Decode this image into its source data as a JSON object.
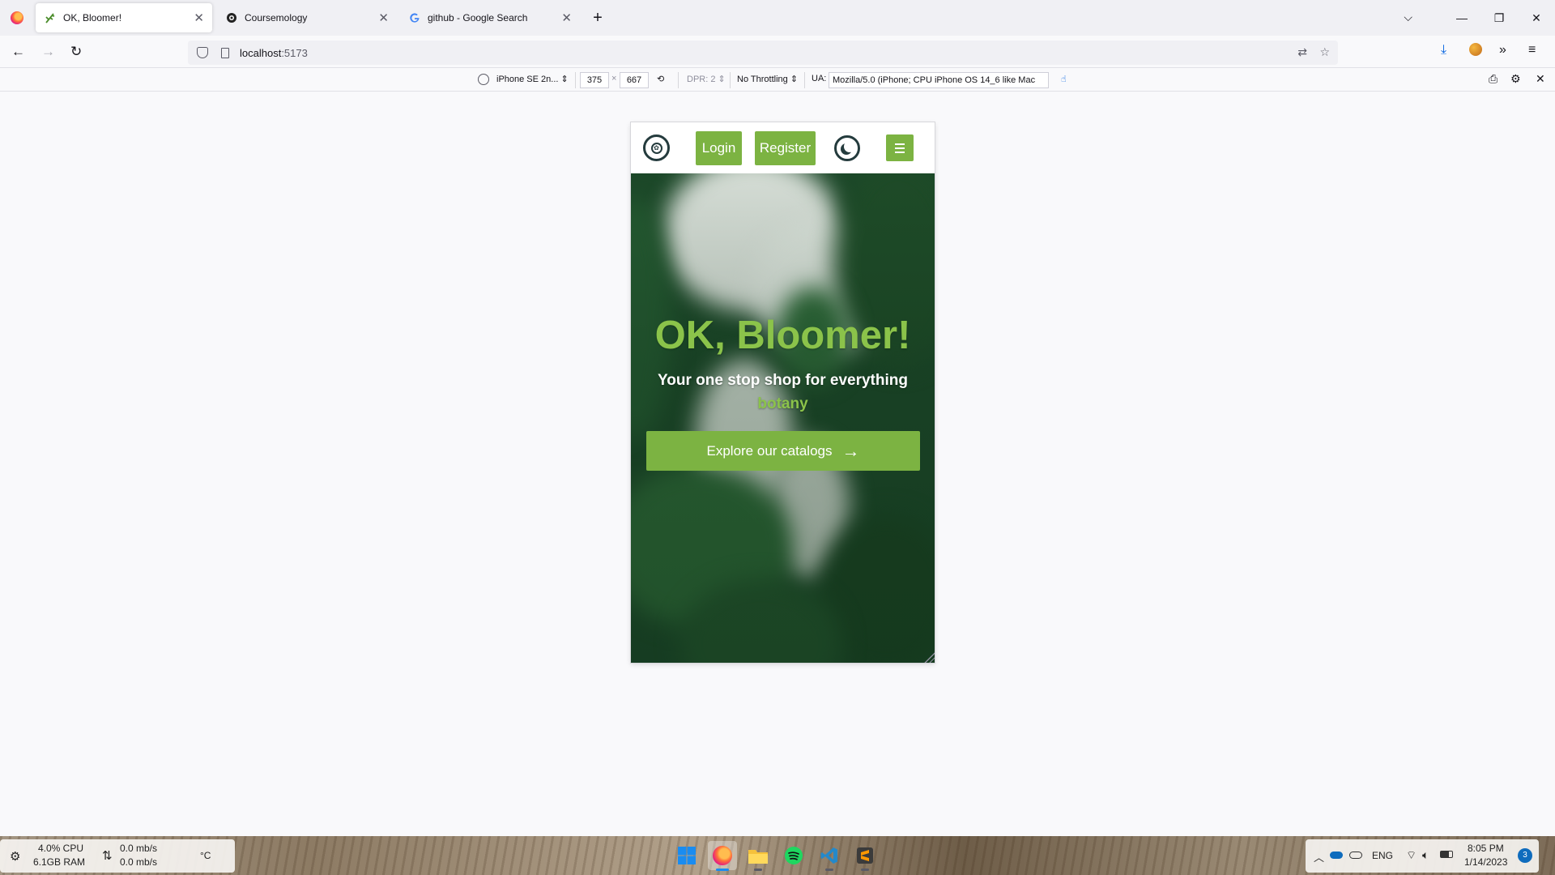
{
  "browser": {
    "tabs": [
      {
        "label": "OK, Bloomer!",
        "active": true
      },
      {
        "label": "Coursemology",
        "active": false
      },
      {
        "label": "github - Google Search",
        "active": false
      }
    ],
    "url_host": "localhost",
    "url_port": ":5173"
  },
  "rdm": {
    "device": "iPhone SE 2n...",
    "width": "375",
    "times": "×",
    "height": "667",
    "dpr": "DPR: 2",
    "throttling": "No Throttling",
    "ua_label": "UA:",
    "ua_value": "Mozilla/5.0 (iPhone; CPU iPhone OS 14_6 like Mac"
  },
  "site": {
    "login_label": "Login",
    "register_label": "Register",
    "hero_title": "OK, Bloomer!",
    "hero_subtitle": "Your one stop shop for everything",
    "hero_accent": "botany",
    "cta_label": "Explore our catalogs",
    "colors": {
      "accent": "#7cb342",
      "dark": "#243b3d"
    }
  },
  "taskbar": {
    "cpu": "4.0% CPU",
    "ram": "6.1GB RAM",
    "net_up": "0.0 mb/s",
    "net_down": "0.0 mb/s",
    "temp": "°C",
    "lang": "ENG",
    "time": "8:05 PM",
    "date": "1/14/2023",
    "notifications": "3"
  }
}
